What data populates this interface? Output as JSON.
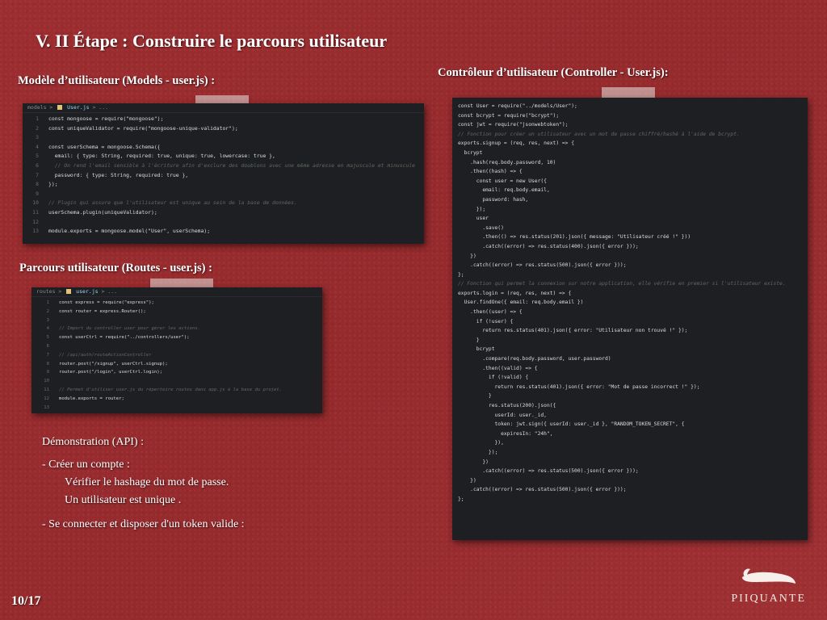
{
  "slide": {
    "title": "V. II Étape : Construire le parcours utilisateur",
    "page_number": "10/17",
    "brand": "PIIQUANTE"
  },
  "models": {
    "label": "Modèle d’utilisateur (Models - user.js) :",
    "breadcrumb": {
      "folder": "models",
      "file": "User.js",
      "rest": "> ..."
    },
    "lines": [
      {
        "n": "1",
        "t": "const mongoose = require(\"mongoose\");"
      },
      {
        "n": "2",
        "t": "const uniqueValidator = require(\"mongoose-unique-validator\");"
      },
      {
        "n": "3",
        "t": ""
      },
      {
        "n": "4",
        "t": "const userSchema = mongoose.Schema({"
      },
      {
        "n": "5",
        "t": "  email: { type: String, required: true, unique: true, lowercase: true },"
      },
      {
        "n": "6",
        "t": "  // On rend l'email sensible à l'écriture afin d'exclure des doublons avec une même adresse en majuscule et minuscule",
        "c": true
      },
      {
        "n": "7",
        "t": "  password: { type: String, required: true },"
      },
      {
        "n": "8",
        "t": "});"
      },
      {
        "n": "9",
        "t": ""
      },
      {
        "n": "10",
        "t": "// Plugin qui assure que l'utilisateur est unique au sein de la base de données.",
        "c": true
      },
      {
        "n": "11",
        "t": "userSchema.plugin(uniqueValidator);"
      },
      {
        "n": "12",
        "t": ""
      },
      {
        "n": "13",
        "t": "module.exports = mongoose.model(\"User\", userSchema);"
      }
    ]
  },
  "routes": {
    "label": "Parcours utilisateur (Routes - user.js) :",
    "breadcrumb": {
      "folder": "routes",
      "file": "user.js",
      "rest": "> ..."
    },
    "lines": [
      {
        "n": "1",
        "t": "const express = require(\"express\");"
      },
      {
        "n": "2",
        "t": "const router = express.Router();"
      },
      {
        "n": "3",
        "t": ""
      },
      {
        "n": "4",
        "t": "// Import du controller user pour gérer les actions.",
        "c": true
      },
      {
        "n": "5",
        "t": "const userCtrl = require(\"../controllers/user\");"
      },
      {
        "n": "6",
        "t": ""
      },
      {
        "n": "7",
        "t": "// /api/auth/routeActionController",
        "c": true
      },
      {
        "n": "8",
        "t": "router.post(\"/signup\", userCtrl.signup);"
      },
      {
        "n": "9",
        "t": "router.post(\"/login\", userCtrl.login);"
      },
      {
        "n": "10",
        "t": ""
      },
      {
        "n": "11",
        "t": "// Permet d'utiliser user.js du répertoire routes dans app.js à la base du projet.",
        "c": true
      },
      {
        "n": "12",
        "t": "module.exports = router;"
      },
      {
        "n": "13",
        "t": ""
      }
    ]
  },
  "controller": {
    "label": "Contrôleur d’utilisateur (Controller - User.js):",
    "lines": [
      {
        "t": "const User = require(\"../models/User\");"
      },
      {
        "t": "const bcrypt = require(\"bcrypt\");"
      },
      {
        "t": "const jwt = require(\"jsonwebtoken\");"
      },
      {
        "t": ""
      },
      {
        "t": "// Fonction pour créer un utilisateur avec un mot de passe chiffré/hashé à l'aide de bcrypt.",
        "c": true
      },
      {
        "t": "exports.signup = (req, res, next) => {"
      },
      {
        "t": "  bcrypt"
      },
      {
        "t": "    .hash(req.body.password, 10)"
      },
      {
        "t": "    .then((hash) => {"
      },
      {
        "t": "      const user = new User({"
      },
      {
        "t": "        email: req.body.email,"
      },
      {
        "t": "        password: hash,"
      },
      {
        "t": "      });"
      },
      {
        "t": "      user"
      },
      {
        "t": "        .save()"
      },
      {
        "t": "        .then(() => res.status(201).json({ message: \"Utilisateur créé !\" }))"
      },
      {
        "t": "        .catch((error) => res.status(400).json({ error }));"
      },
      {
        "t": "    })"
      },
      {
        "t": "    .catch((error) => res.status(500).json({ error }));"
      },
      {
        "t": "};"
      },
      {
        "t": ""
      },
      {
        "t": "// Fonction qui permet la connexion sur notre application, elle vérifie en premier si l'utilisateur existe.",
        "c": true
      },
      {
        "t": "exports.login = (req, res, next) => {"
      },
      {
        "t": "  User.findOne({ email: req.body.email })"
      },
      {
        "t": "    .then((user) => {"
      },
      {
        "t": "      if (!user) {"
      },
      {
        "t": "        return res.status(401).json({ error: \"Utilisateur non trouvé !\" });"
      },
      {
        "t": "      }"
      },
      {
        "t": "      bcrypt"
      },
      {
        "t": "        .compare(req.body.password, user.password)"
      },
      {
        "t": "        .then((valid) => {"
      },
      {
        "t": "          if (!valid) {"
      },
      {
        "t": "            return res.status(401).json({ error: \"Mot de passe incorrect !\" });"
      },
      {
        "t": "          }"
      },
      {
        "t": "          res.status(200).json({"
      },
      {
        "t": "            userId: user._id,"
      },
      {
        "t": "            token: jwt.sign({ userId: user._id }, \"RANDOM_TOKEN_SECRET\", {"
      },
      {
        "t": "              expiresIn: \"24h\","
      },
      {
        "t": "            }),"
      },
      {
        "t": "          });"
      },
      {
        "t": "        })"
      },
      {
        "t": "        .catch((error) => res.status(500).json({ error }));"
      },
      {
        "t": "    })"
      },
      {
        "t": "    .catch((error) => res.status(500).json({ error }));"
      },
      {
        "t": "};"
      }
    ]
  },
  "demo": {
    "heading": "Démonstration (API) :",
    "item1": "- Créer un compte :",
    "item1_sub1": "Vérifier le hashage du mot de passe.",
    "item1_sub2": "Un utilisateur est unique .",
    "item2": "- Se connecter et disposer d'un token valide :"
  }
}
